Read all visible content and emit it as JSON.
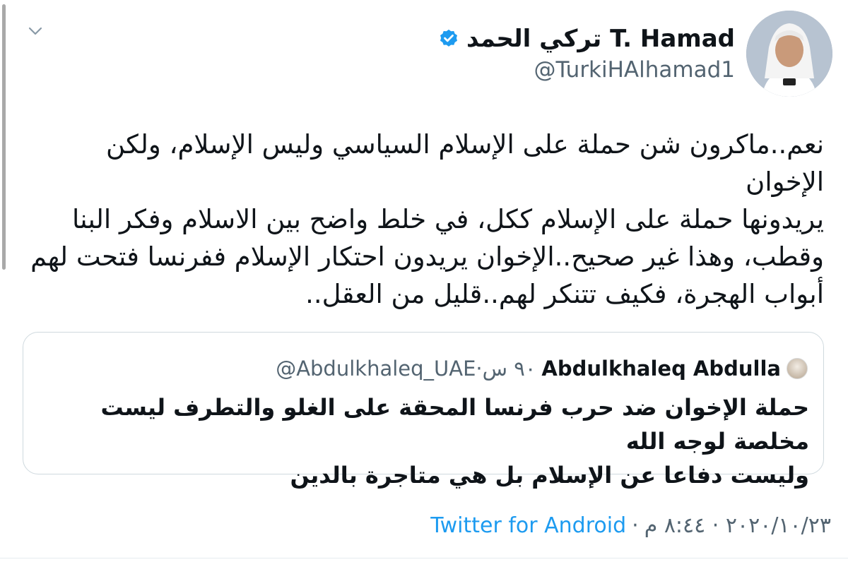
{
  "tweet": {
    "author": {
      "display_name": "تركي الحمد T. Hamad",
      "handle": "@TurkiHAlhamad1",
      "verified": true,
      "avatar_icon": "profile-photo"
    },
    "text_lines": [
      "نعم..ماكرون شن حملة على الإسلام السياسي وليس الإسلام، ولكن الإخوان",
      "يريدونها حملة على الإسلام ككل، في خلط واضح بين الاسلام وفكر البنا",
      "وقطب، وهذا غير صحيح..الإخوان يريدون احتكار الإسلام ففرنسا فتحت لهم",
      "أبواب الهجرة، فكيف تتنكر لهم..قليل من العقل.."
    ],
    "quoted": {
      "author_name": "Abdulkhaleq Abdulla",
      "handle_time": "@Abdulkhaleq_UAE·٩٠ س",
      "text_lines": [
        "حملة الإخوان ضد حرب فرنسا المحقة على الغلو والتطرف ليست مخلصة لوجه الله",
        "وليست دفاعا عن الإسلام بل هي متاجرة بالدين"
      ]
    },
    "meta": {
      "date_time": "٢٠٢٠/١٠/٢٣ · ٨:٤٤ م",
      "separator": "·",
      "source": "Twitter for Android"
    }
  },
  "colors": {
    "text": "#0f1419",
    "secondary": "#536471",
    "accent": "#1d9bf0",
    "border": "#cfd9de"
  },
  "icons": {
    "more": "chevron-down-icon",
    "verified": "verified-badge-icon"
  }
}
